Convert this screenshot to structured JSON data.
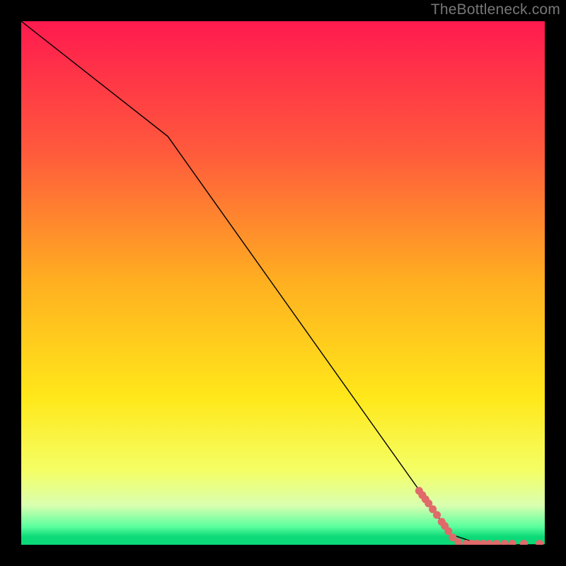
{
  "attribution": "TheBottleneck.com",
  "chart_data": {
    "type": "line",
    "title": "",
    "xlabel": "",
    "ylabel": "",
    "xlim": [
      0,
      100
    ],
    "ylim": [
      0,
      100
    ],
    "background_gradient": {
      "stops": [
        {
          "offset": 0.0,
          "color": "#ff1a4f"
        },
        {
          "offset": 0.25,
          "color": "#ff5a3c"
        },
        {
          "offset": 0.5,
          "color": "#ffb020"
        },
        {
          "offset": 0.72,
          "color": "#ffe81a"
        },
        {
          "offset": 0.86,
          "color": "#f4ff66"
        },
        {
          "offset": 0.925,
          "color": "#d9ffb0"
        },
        {
          "offset": 0.965,
          "color": "#5cff9e"
        },
        {
          "offset": 0.985,
          "color": "#0cd977"
        },
        {
          "offset": 1.0,
          "color": "#0cd977"
        }
      ]
    },
    "series": [
      {
        "name": "curve",
        "type": "line",
        "color": "#000000",
        "width": 1.4,
        "points": [
          {
            "x": 0,
            "y": 100
          },
          {
            "x": 28,
            "y": 78
          },
          {
            "x": 82,
            "y": 2
          },
          {
            "x": 88,
            "y": 0
          },
          {
            "x": 100,
            "y": 0
          }
        ]
      },
      {
        "name": "threshold-markers",
        "type": "scatter",
        "color": "#e06a6a",
        "radius": 5.5,
        "points": [
          {
            "x": 76.0,
            "y": 10.3
          },
          {
            "x": 76.6,
            "y": 9.5
          },
          {
            "x": 77.2,
            "y": 8.7
          },
          {
            "x": 77.8,
            "y": 7.9
          },
          {
            "x": 78.6,
            "y": 6.8
          },
          {
            "x": 79.4,
            "y": 5.7
          },
          {
            "x": 80.3,
            "y": 4.4
          },
          {
            "x": 80.9,
            "y": 3.6
          },
          {
            "x": 81.6,
            "y": 2.6
          },
          {
            "x": 82.4,
            "y": 1.4
          },
          {
            "x": 83.5,
            "y": 0.5
          },
          {
            "x": 85.0,
            "y": 0.2
          },
          {
            "x": 86.0,
            "y": 0.2
          },
          {
            "x": 87.0,
            "y": 0.2
          },
          {
            "x": 88.2,
            "y": 0.2
          },
          {
            "x": 89.4,
            "y": 0.2
          },
          {
            "x": 90.8,
            "y": 0.2
          },
          {
            "x": 92.3,
            "y": 0.2
          },
          {
            "x": 93.8,
            "y": 0.2
          },
          {
            "x": 96.0,
            "y": 0.2
          },
          {
            "x": 99.0,
            "y": 0.2
          }
        ]
      }
    ]
  }
}
